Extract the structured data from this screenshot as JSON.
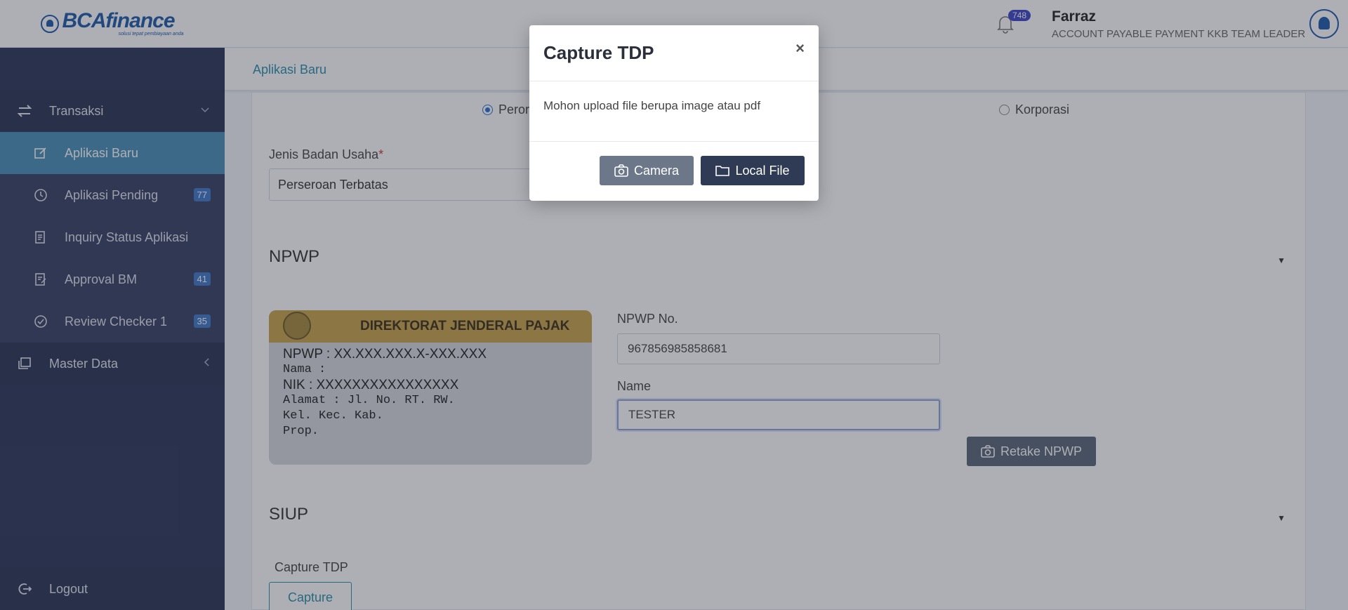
{
  "brand": {
    "name": "BCAfinance",
    "tagline": "solusi tepat pembiayaan anda"
  },
  "header": {
    "notifications_count": "748",
    "user_name": "Farraz",
    "user_role": "ACCOUNT PAYABLE PAYMENT KKB TEAM LEADER"
  },
  "breadcrumb": {
    "current": "Aplikasi Baru"
  },
  "sidebar": {
    "transaksi_label": "Transaksi",
    "items": [
      {
        "label": "Aplikasi Baru",
        "badge": ""
      },
      {
        "label": "Aplikasi Pending",
        "badge": "77"
      },
      {
        "label": "Inquiry Status Aplikasi",
        "badge": ""
      },
      {
        "label": "Approval BM",
        "badge": "41"
      },
      {
        "label": "Review Checker 1",
        "badge": "35"
      }
    ],
    "master_label": "Master Data",
    "logout_label": "Logout"
  },
  "form": {
    "radio_perorangan": "Perorangan",
    "radio_korporasi": "Korporasi",
    "jenis_label": "Jenis Badan Usaha",
    "jenis_required": "*",
    "jenis_value": "Perseroan Terbatas",
    "npwp_section": "NPWP",
    "npwp_no_label": "NPWP No.",
    "npwp_no_value": "967856985858681",
    "name_label": "Name",
    "name_value": "TESTER",
    "retake_label": "Retake NPWP",
    "siup_section": "SIUP",
    "capture_tdp_label": "Capture TDP",
    "capture_button": "Capture"
  },
  "npwp_card": {
    "header": "DIREKTORAT JENDERAL PAJAK",
    "npwp_line": "NPWP :  XX.XXX.XXX.X-XXX.XXX",
    "nama_line": "Nama :",
    "nik_line": "NIK   : XXXXXXXXXXXXXXXX",
    "alamat_line": "Alamat : Jl.        No.    RT.  RW.",
    "kel_line": "Kel.            Kec.            Kab.",
    "prop_line": "Prop."
  },
  "modal": {
    "title": "Capture TDP",
    "close": "×",
    "message": "Mohon upload file berupa image atau pdf",
    "camera_label": "Camera",
    "local_file_label": "Local File"
  },
  "colors": {
    "sidebar_bg": "#2c3557",
    "active_item": "#4a8fb5",
    "accent_link": "#2b8fa8",
    "badge": "#3f78c7"
  }
}
